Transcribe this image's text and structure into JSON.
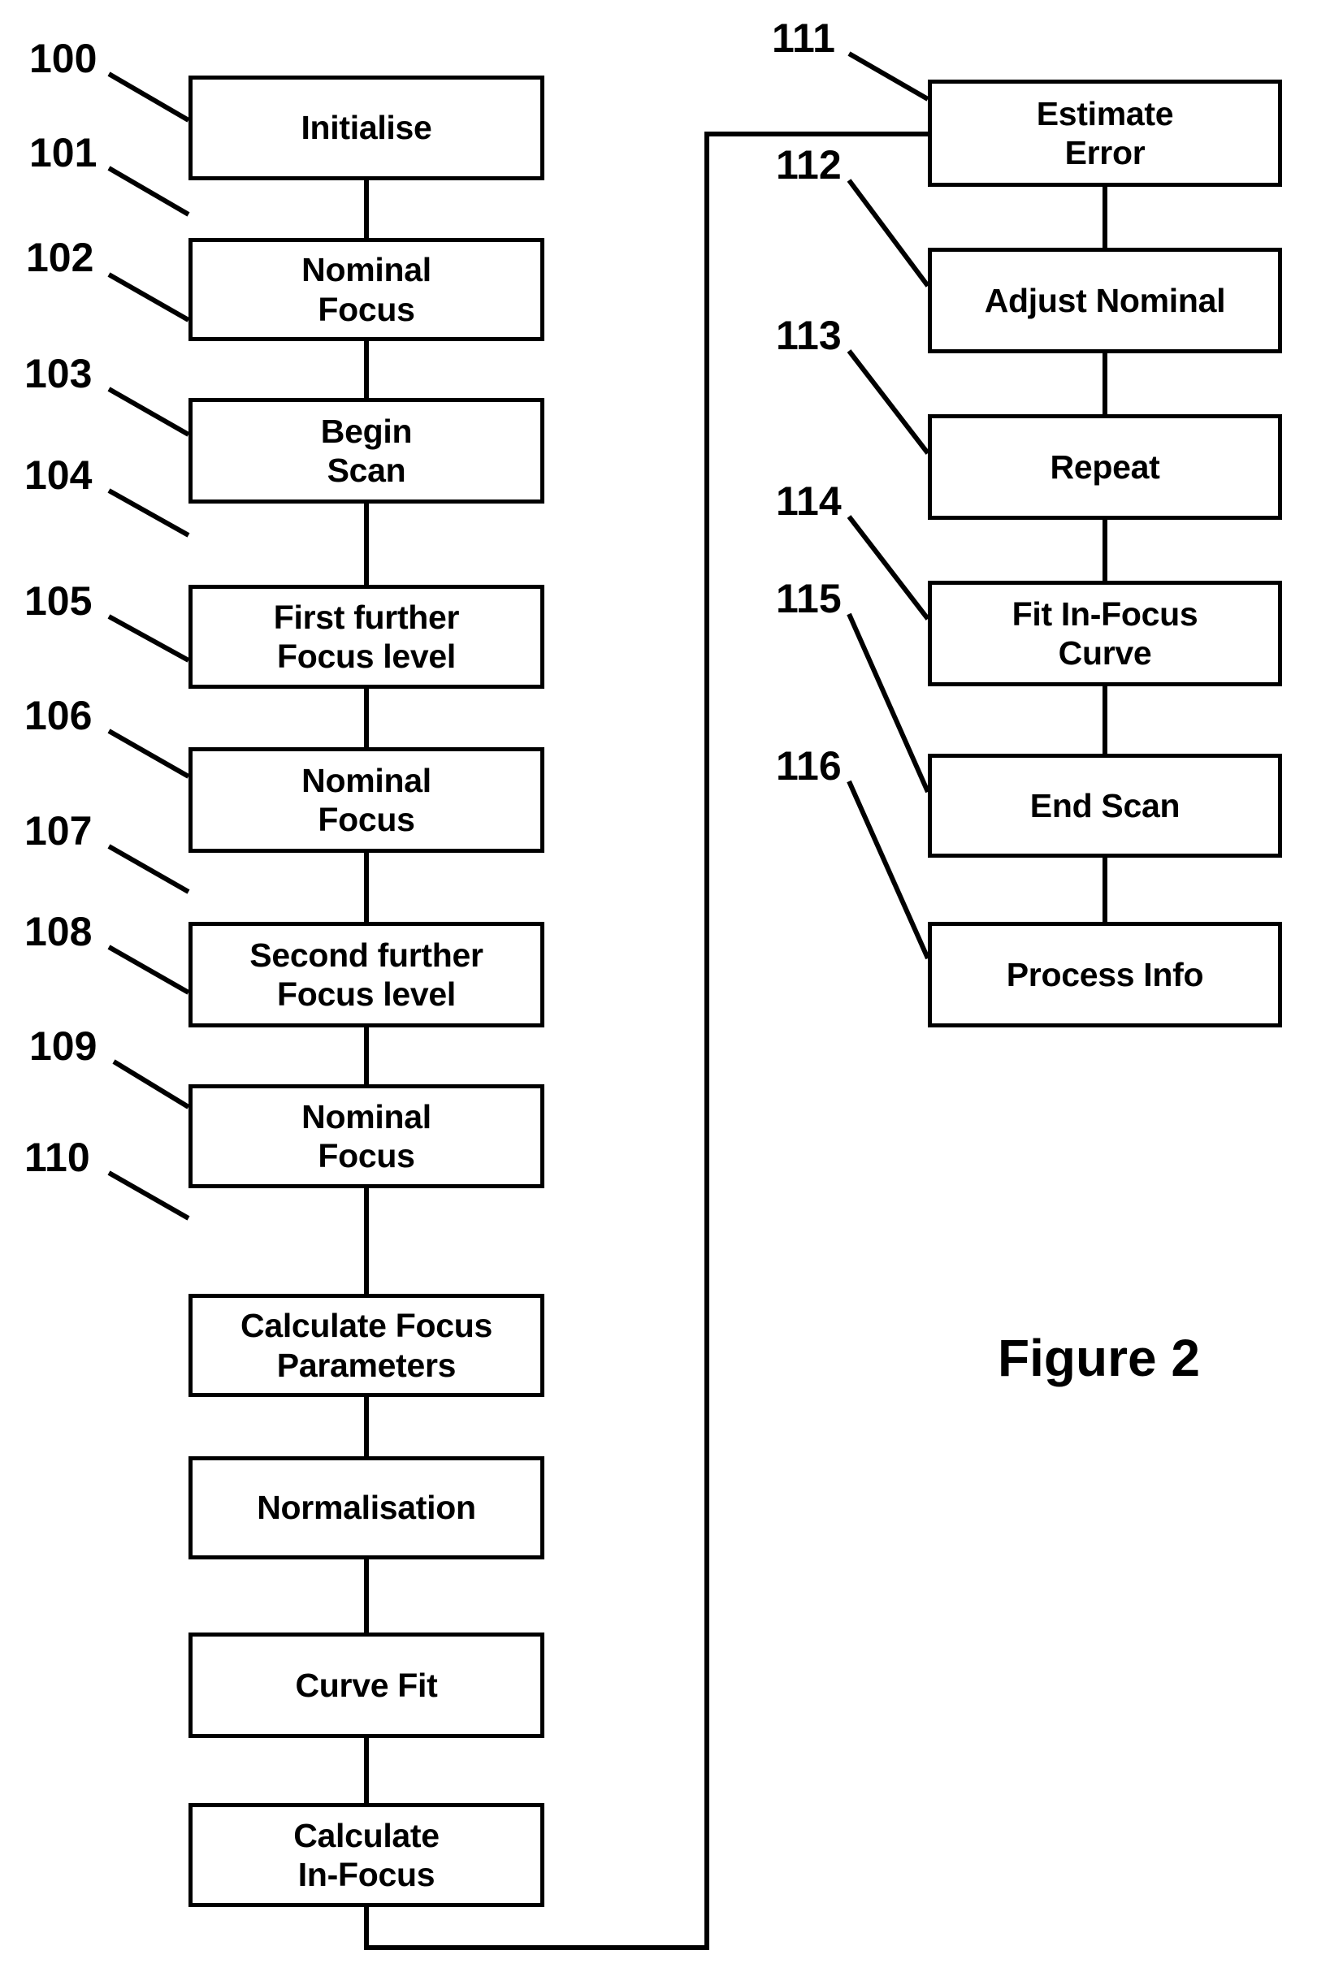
{
  "figure": {
    "caption": "Figure 2",
    "type": "flowchart",
    "orientation": "two-column, top-to-bottom, with feedback loop"
  },
  "left_column": {
    "steps": [
      {
        "ref": "100",
        "label": "Initialise",
        "lines": [
          "Initialise"
        ]
      },
      {
        "ref": "101",
        "label": "Nominal Focus",
        "lines": [
          "Nominal",
          "Focus"
        ]
      },
      {
        "ref": "102",
        "label": "Begin Scan",
        "lines": [
          "Begin",
          "Scan"
        ]
      },
      {
        "ref": "103",
        "label": "First further Focus level",
        "lines": [
          "First further",
          "Focus level"
        ]
      },
      {
        "ref": "104",
        "label": "Nominal Focus",
        "lines": [
          "Nominal",
          "Focus"
        ]
      },
      {
        "ref": "105",
        "label": "Second further Focus level",
        "lines": [
          "Second further",
          "Focus level"
        ]
      },
      {
        "ref": "106",
        "label": "Nominal Focus",
        "lines": [
          "Nominal",
          "Focus"
        ]
      },
      {
        "ref": "107",
        "label": "Calculate Focus Parameters",
        "lines": [
          "Calculate Focus",
          "Parameters"
        ]
      },
      {
        "ref": "108",
        "label": "Normalisation",
        "lines": [
          "Normalisation"
        ]
      },
      {
        "ref": "109",
        "label": "Curve Fit",
        "lines": [
          "Curve Fit"
        ]
      },
      {
        "ref": "110",
        "label": "Calculate In-Focus",
        "lines": [
          "Calculate",
          "In-Focus"
        ]
      }
    ]
  },
  "right_column": {
    "steps": [
      {
        "ref": "111",
        "label": "Estimate Error",
        "lines": [
          "Estimate",
          "Error"
        ]
      },
      {
        "ref": "112",
        "label": "Adjust Nominal",
        "lines": [
          "Adjust Nominal"
        ]
      },
      {
        "ref": "113",
        "label": "Repeat",
        "lines": [
          "Repeat"
        ]
      },
      {
        "ref": "114",
        "label": "Fit In-Focus Curve",
        "lines": [
          "Fit In-Focus",
          "Curve"
        ]
      },
      {
        "ref": "115",
        "label": "End Scan",
        "lines": [
          "End Scan"
        ]
      },
      {
        "ref": "116",
        "label": "Process Info",
        "lines": [
          "Process Info"
        ]
      }
    ]
  },
  "colors": {
    "stroke": "#000000",
    "fill": "#ffffff",
    "text": "#000000"
  }
}
